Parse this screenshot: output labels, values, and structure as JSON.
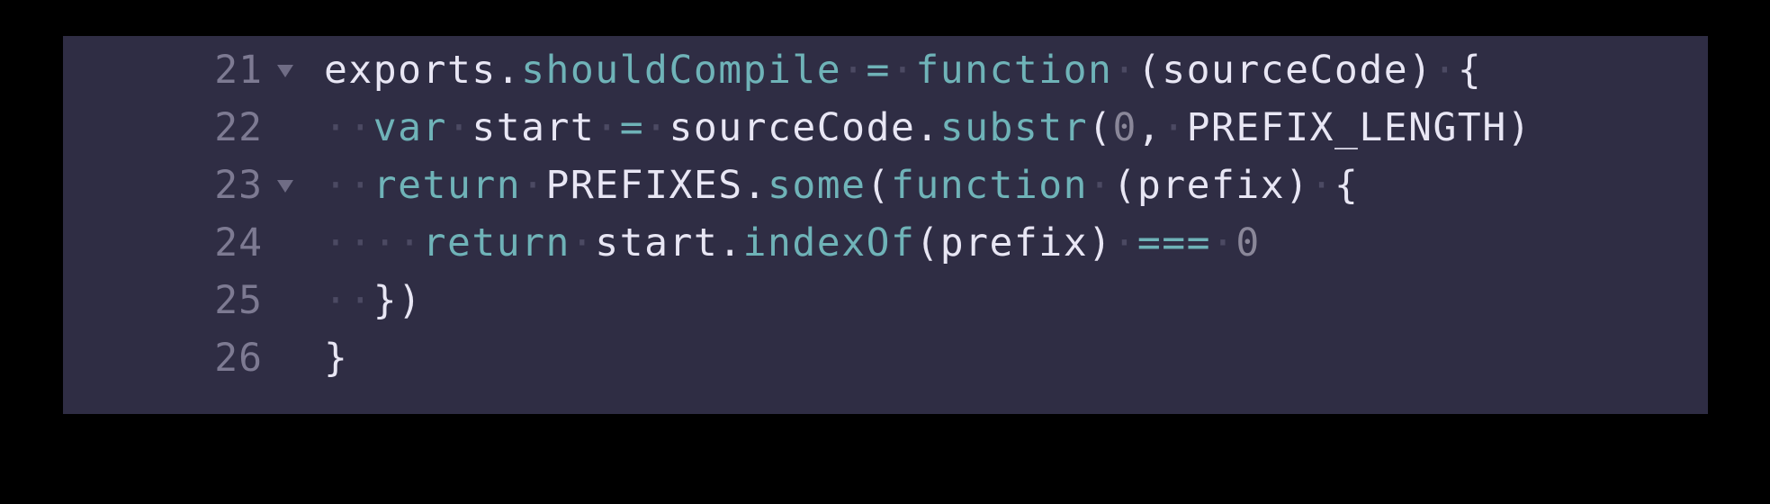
{
  "editor": {
    "lines": [
      {
        "number": "21",
        "foldable": true,
        "tokens": [
          {
            "t": "exports.",
            "c": "plain"
          },
          {
            "t": "shouldCompile",
            "c": "fn"
          },
          {
            "t": "·",
            "c": "ws"
          },
          {
            "t": "=",
            "c": "op"
          },
          {
            "t": "·",
            "c": "ws"
          },
          {
            "t": "function",
            "c": "kw"
          },
          {
            "t": "·",
            "c": "ws"
          },
          {
            "t": "(sourceCode)",
            "c": "plain"
          },
          {
            "t": "·",
            "c": "ws"
          },
          {
            "t": "{",
            "c": "plain"
          }
        ]
      },
      {
        "number": "22",
        "foldable": false,
        "tokens": [
          {
            "t": "··",
            "c": "ws"
          },
          {
            "t": "var",
            "c": "kw"
          },
          {
            "t": "·",
            "c": "ws"
          },
          {
            "t": "start",
            "c": "plain"
          },
          {
            "t": "·",
            "c": "ws"
          },
          {
            "t": "=",
            "c": "op"
          },
          {
            "t": "·",
            "c": "ws"
          },
          {
            "t": "sourceCode.",
            "c": "plain"
          },
          {
            "t": "substr",
            "c": "fn"
          },
          {
            "t": "(",
            "c": "plain"
          },
          {
            "t": "0",
            "c": "num"
          },
          {
            "t": ",",
            "c": "plain"
          },
          {
            "t": "·",
            "c": "ws"
          },
          {
            "t": "PREFIX_LENGTH)",
            "c": "plain"
          }
        ]
      },
      {
        "number": "23",
        "foldable": true,
        "tokens": [
          {
            "t": "··",
            "c": "ws"
          },
          {
            "t": "return",
            "c": "kw"
          },
          {
            "t": "·",
            "c": "ws"
          },
          {
            "t": "PREFIXES.",
            "c": "plain"
          },
          {
            "t": "some",
            "c": "fn"
          },
          {
            "t": "(",
            "c": "plain"
          },
          {
            "t": "function",
            "c": "kw"
          },
          {
            "t": "·",
            "c": "ws"
          },
          {
            "t": "(prefix)",
            "c": "plain"
          },
          {
            "t": "·",
            "c": "ws"
          },
          {
            "t": "{",
            "c": "plain"
          }
        ]
      },
      {
        "number": "24",
        "foldable": false,
        "tokens": [
          {
            "t": "····",
            "c": "ws"
          },
          {
            "t": "return",
            "c": "kw"
          },
          {
            "t": "·",
            "c": "ws"
          },
          {
            "t": "start.",
            "c": "plain"
          },
          {
            "t": "indexOf",
            "c": "fn"
          },
          {
            "t": "(prefix)",
            "c": "plain"
          },
          {
            "t": "·",
            "c": "ws"
          },
          {
            "t": "===",
            "c": "op"
          },
          {
            "t": "·",
            "c": "ws"
          },
          {
            "t": "0",
            "c": "num"
          }
        ]
      },
      {
        "number": "25",
        "foldable": false,
        "tokens": [
          {
            "t": "··",
            "c": "ws"
          },
          {
            "t": "})",
            "c": "plain"
          }
        ]
      },
      {
        "number": "26",
        "foldable": false,
        "tokens": [
          {
            "t": "}",
            "c": "plain"
          }
        ]
      }
    ]
  },
  "colors": {
    "background": "#000000",
    "editor_bg": "#2f2d44",
    "text": "#e8e6f4",
    "keyword": "#6fb3b8",
    "gutter": "#7d7a92",
    "whitespace": "#4c4a63"
  }
}
